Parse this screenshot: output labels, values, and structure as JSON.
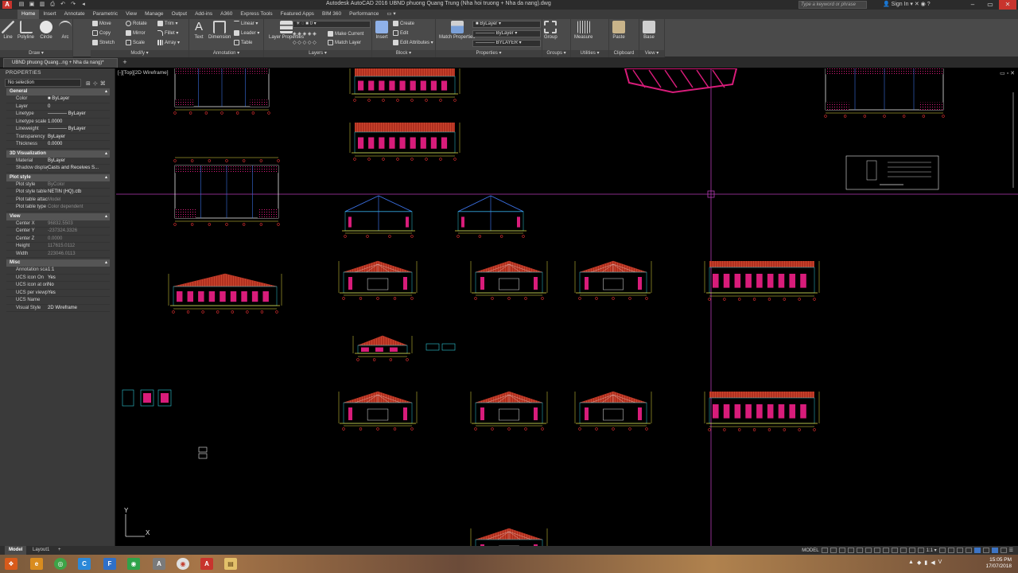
{
  "app": {
    "logo_letter": "A",
    "title": "Autodesk AutoCAD 2016    UBND phuong Quang Trung (Nha hoi truong + Nha da nang).dwg",
    "search_placeholder": "Type a keyword or phrase",
    "signin": "Sign In",
    "quick_access": [
      "▤",
      "▣",
      "▥",
      "⎙",
      "↶",
      "↷",
      "◂"
    ]
  },
  "ribbon_tabs": [
    "Home",
    "Insert",
    "Annotate",
    "Parametric",
    "View",
    "Manage",
    "Output",
    "Add-ins",
    "A360",
    "Express Tools",
    "Featured Apps",
    "BIM 360",
    "Performance",
    "▭ ▾"
  ],
  "ribbon": {
    "draw": {
      "label": "Draw ▾",
      "line": "Line",
      "polyline": "Polyline",
      "circle": "Circle",
      "arc": "Arc"
    },
    "modify": {
      "label": "Modify ▾",
      "move": "Move",
      "rotate": "Rotate",
      "trim": "Trim ▾",
      "copy": "Copy",
      "mirror": "Mirror",
      "fillet": "Fillet ▾",
      "stretch": "Stretch",
      "scale": "Scale",
      "array": "Array ▾"
    },
    "annotation": {
      "label": "Annotation ▾",
      "text": "Text",
      "dimension": "Dimension",
      "linear": "Linear ▾",
      "leader": "Leader ▾",
      "table": "Table"
    },
    "layers": {
      "label": "Layers ▾",
      "layer_properties": "Layer Properties",
      "layer_combo": "0",
      "make_current": "Make Current",
      "match_layer": "Match Layer"
    },
    "block": {
      "label": "Block ▾",
      "insert": "Insert",
      "create": "Create",
      "edit": "Edit",
      "edit_attributes": "Edit Attributes ▾"
    },
    "properties": {
      "label": "Properties ▾",
      "match_properties": "Match Properties",
      "color_combo": "ByLayer",
      "linetype_combo": "ByLayer",
      "lineweight_combo": "BYLAYER"
    },
    "groups": {
      "label": "Groups ▾",
      "group": "Group"
    },
    "utilities": {
      "label": "Utilities ▾",
      "measure": "Measure"
    },
    "clipboard": {
      "label": "Clipboard",
      "paste": "Paste"
    },
    "view": {
      "label": "View ▾",
      "base": "Base"
    }
  },
  "file_tab": "UBND phuong Quang...ng + Nha da nang)*",
  "new_tab": "+",
  "properties_palette": {
    "title": "PROPERTIES",
    "selection": "No selection",
    "sections": [
      {
        "name": "General",
        "rows": [
          {
            "k": "Color",
            "v": "■ ByLayer"
          },
          {
            "k": "Layer",
            "v": "0"
          },
          {
            "k": "Linetype",
            "v": "———— ByLayer"
          },
          {
            "k": "Linetype scale",
            "v": "1.0000"
          },
          {
            "k": "Lineweight",
            "v": "———— ByLayer"
          },
          {
            "k": "Transparency",
            "v": "ByLayer"
          },
          {
            "k": "Thickness",
            "v": "0.0000"
          }
        ]
      },
      {
        "name": "3D Visualization",
        "rows": [
          {
            "k": "Material",
            "v": "ByLayer"
          },
          {
            "k": "Shadow display",
            "v": "Casts and Receives S..."
          }
        ]
      },
      {
        "name": "Plot style",
        "rows": [
          {
            "k": "Plot style",
            "v": "ByColor",
            "dim": true
          },
          {
            "k": "Plot style table",
            "v": "NETIN (HQ).ctb"
          },
          {
            "k": "Plot table attach...",
            "v": "Model",
            "dim": true
          },
          {
            "k": "Plot table type",
            "v": "Color dependent",
            "dim": true
          }
        ]
      },
      {
        "name": "View",
        "rows": [
          {
            "k": "Center X",
            "v": "96832.5503",
            "dim": true
          },
          {
            "k": "Center Y",
            "v": "-237324.3326",
            "dim": true
          },
          {
            "k": "Center Z",
            "v": "0.0000",
            "dim": true
          },
          {
            "k": "Height",
            "v": "117615.0112",
            "dim": true
          },
          {
            "k": "Width",
            "v": "223046.0113",
            "dim": true
          }
        ]
      },
      {
        "name": "Misc",
        "rows": [
          {
            "k": "Annotation scale",
            "v": "1:1"
          },
          {
            "k": "UCS icon On",
            "v": "Yes"
          },
          {
            "k": "UCS icon at origin",
            "v": "No"
          },
          {
            "k": "UCS per viewport",
            "v": "Yes"
          },
          {
            "k": "UCS Name",
            "v": ""
          },
          {
            "k": "Visual Style",
            "v": "2D Wireframe"
          }
        ]
      }
    ]
  },
  "viewport": {
    "label": "[-][Top][2D Wireframe]",
    "controls": "▭ ▫ ✕"
  },
  "ucs": {
    "x": "X",
    "y": "Y"
  },
  "layout_tabs": [
    "Model",
    "Layout1",
    "+"
  ],
  "status": {
    "model": "MODEL",
    "scale": "1:1 ▾"
  },
  "taskbar": {
    "time": "15:05 PM",
    "date": "17/07/2018",
    "apps": [
      "❖",
      "e",
      "◎",
      "C",
      "F",
      "◉",
      "A",
      "▤"
    ]
  },
  "colors": {
    "canvas": "#000000",
    "crosshair": "#b43cb4",
    "roof": "#c23a2a",
    "wall": "#d81c7a",
    "dim_yellow": "#e8e040",
    "dim_red": "#e03030",
    "structure_blue": "#3a6fe0",
    "cyan": "#30c8d8"
  }
}
